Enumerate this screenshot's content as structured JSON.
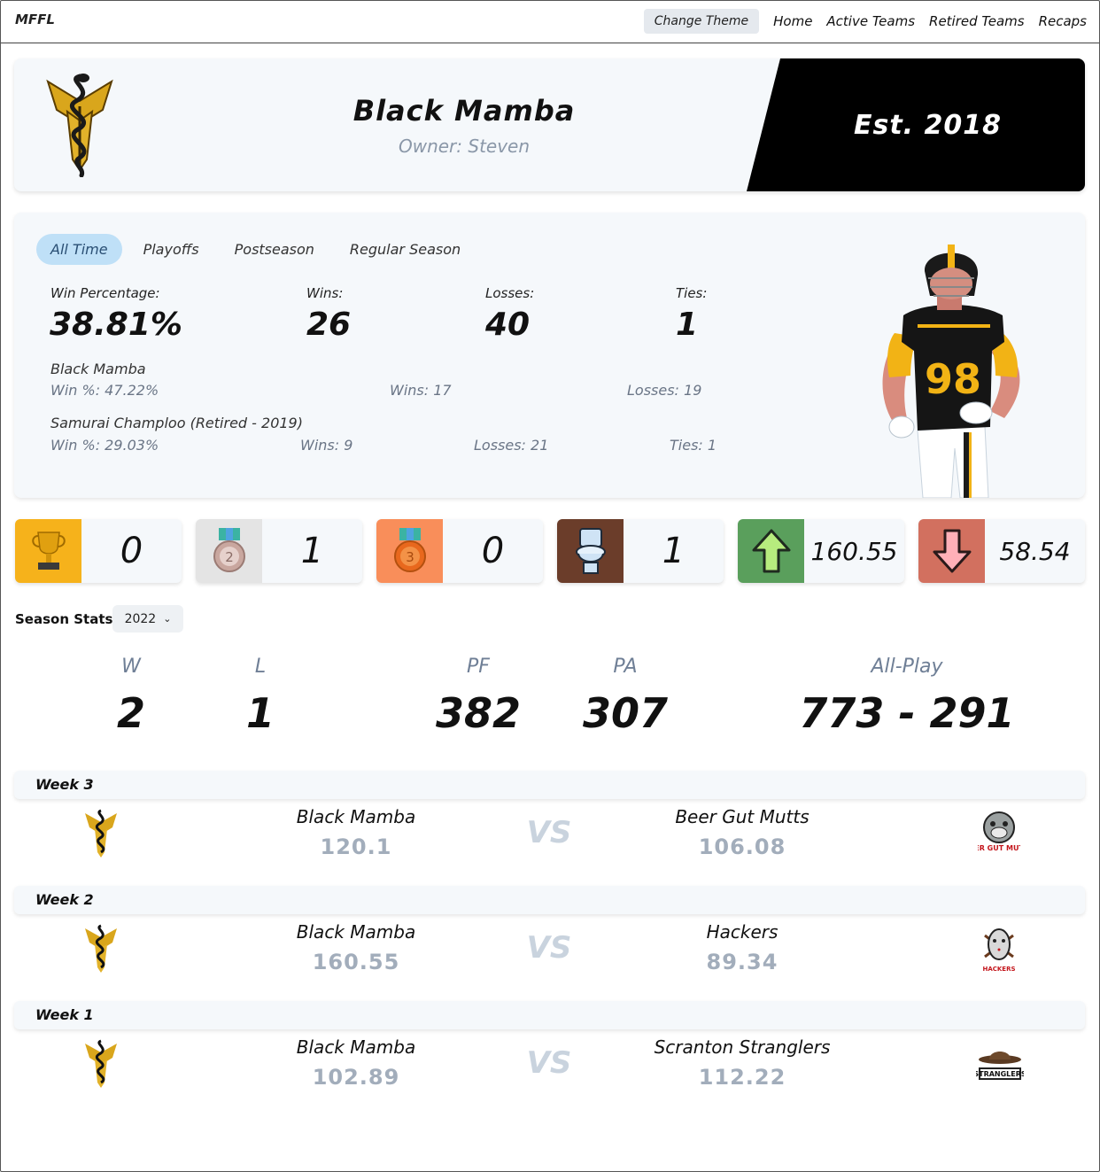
{
  "nav": {
    "brand": "MFFL",
    "theme_button": "Change Theme",
    "links": [
      "Home",
      "Active Teams",
      "Retired Teams",
      "Recaps"
    ]
  },
  "header": {
    "team_name": "Black Mamba",
    "owner": "Owner: Steven",
    "established": "Est. 2018"
  },
  "stats": {
    "tabs": [
      "All Time",
      "Playoffs",
      "Postseason",
      "Regular Season"
    ],
    "active_tab": "All Time",
    "win_pct_label": "Win Percentage:",
    "win_pct": "38.81%",
    "wins_label": "Wins:",
    "wins": "26",
    "losses_label": "Losses:",
    "losses": "40",
    "ties_label": "Ties:",
    "ties": "1",
    "history": [
      {
        "name": "Black Mamba",
        "win_pct": "Win %: 47.22%",
        "wins": "Wins: 17",
        "losses": "Losses: 19",
        "ties": ""
      },
      {
        "name": "Samurai Champloo (Retired - 2019)",
        "win_pct": "Win %: 29.03%",
        "wins": "Wins: 9",
        "losses": "Losses: 21",
        "ties": "Ties: 1"
      }
    ],
    "player_jersey_number": "98"
  },
  "awards": [
    {
      "icon": "trophy-icon",
      "value": "0",
      "color": "#f6b21b"
    },
    {
      "icon": "silver-medal-icon",
      "value": "1",
      "color": "#e4e4e4"
    },
    {
      "icon": "bronze-medal-icon",
      "value": "0",
      "color": "#f98e5a"
    },
    {
      "icon": "toilet-icon",
      "value": "1",
      "color": "#6b3d2a"
    },
    {
      "icon": "arrow-up-icon",
      "value": "160.55",
      "color": "#5a9f5c"
    },
    {
      "icon": "arrow-down-icon",
      "value": "58.54",
      "color": "#d2705f"
    }
  ],
  "season": {
    "label": "Season Stats:",
    "selected_year": "2022",
    "headers": {
      "w": "W",
      "l": "L",
      "pf": "PF",
      "pa": "PA",
      "allplay": "All-Play"
    },
    "values": {
      "w": "2",
      "l": "1",
      "pf": "382",
      "pa": "307",
      "allplay": "773 - 291"
    }
  },
  "matchups": [
    {
      "week": "Week 3",
      "home": "Black Mamba",
      "home_score": "120.1",
      "vs": "VS",
      "away": "Beer Gut Mutts",
      "away_score": "106.08",
      "away_logo": "bulldog-logo-icon",
      "away_logo_text": "BEER GUT MUTTS"
    },
    {
      "week": "Week 2",
      "home": "Black Mamba",
      "home_score": "160.55",
      "vs": "VS",
      "away": "Hackers",
      "away_score": "89.34",
      "away_logo": "hockey-mask-logo-icon",
      "away_logo_text": "HACKERS"
    },
    {
      "week": "Week 1",
      "home": "Black Mamba",
      "home_score": "102.89",
      "vs": "VS",
      "away": "Scranton Stranglers",
      "away_score": "112.22",
      "away_logo": "cowboy-hat-logo-icon",
      "away_logo_text": "STRANGLERS"
    }
  ]
}
